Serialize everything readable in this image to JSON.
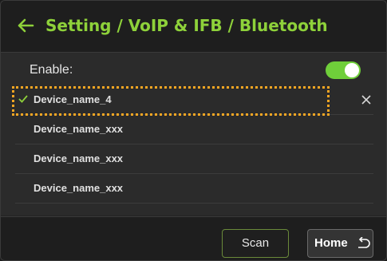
{
  "header": {
    "title": "Setting / VoIP & IFB / Bluetooth",
    "back_icon": "arrow-left-icon"
  },
  "enable": {
    "label": "Enable:",
    "on": true
  },
  "devices": [
    {
      "name": "Device_name_4",
      "selected": true
    },
    {
      "name": "Device_name_xxx",
      "selected": false
    },
    {
      "name": "Device_name_xxx",
      "selected": false
    },
    {
      "name": "Device_name_xxx",
      "selected": false
    }
  ],
  "footer": {
    "scan_label": "Scan",
    "home_label": "Home",
    "home_icon": "return-icon"
  },
  "colors": {
    "accent": "#8ed13a",
    "toggle_on": "#6fcf3a",
    "selection_outline": "#f5a623"
  }
}
